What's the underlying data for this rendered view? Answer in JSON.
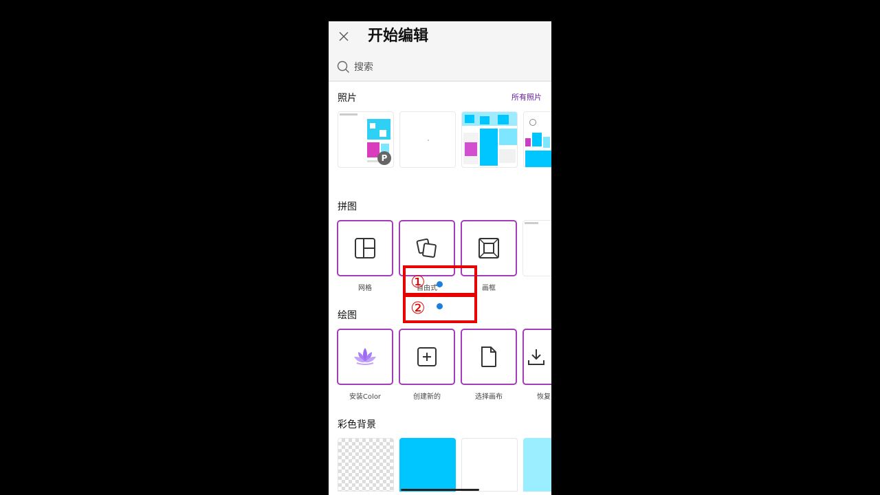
{
  "header": {
    "title": "开始编辑",
    "close_icon": "close-icon"
  },
  "search": {
    "label": "搜索",
    "icon": "search-icon"
  },
  "photos": {
    "title": "照片",
    "all_link": "所有照片",
    "badge": "P"
  },
  "collage": {
    "title": "拼图",
    "items": [
      {
        "label": "网格",
        "icon": "grid-layout-icon"
      },
      {
        "label": "自由式",
        "icon": "freestyle-icon"
      },
      {
        "label": "画框",
        "icon": "frame-icon"
      }
    ]
  },
  "drawing": {
    "title": "绘图",
    "items": [
      {
        "label": "安装Color",
        "icon": "lotus-icon"
      },
      {
        "label": "创建新的",
        "icon": "add-square-icon"
      },
      {
        "label": "选择画布",
        "icon": "blank-page-icon"
      },
      {
        "label": "恢复",
        "icon": "download-icon"
      }
    ]
  },
  "backgrounds": {
    "title": "彩色背景",
    "colors": [
      "transparent",
      "#00c6ff",
      "#ffffff",
      "#9beeff"
    ]
  },
  "annotations": {
    "first": "①",
    "second": "②",
    "color": "#e60000",
    "dot_color": "#1a7fe0"
  },
  "colors": {
    "accent": "#a43bb8",
    "link": "#6a1fa3"
  }
}
